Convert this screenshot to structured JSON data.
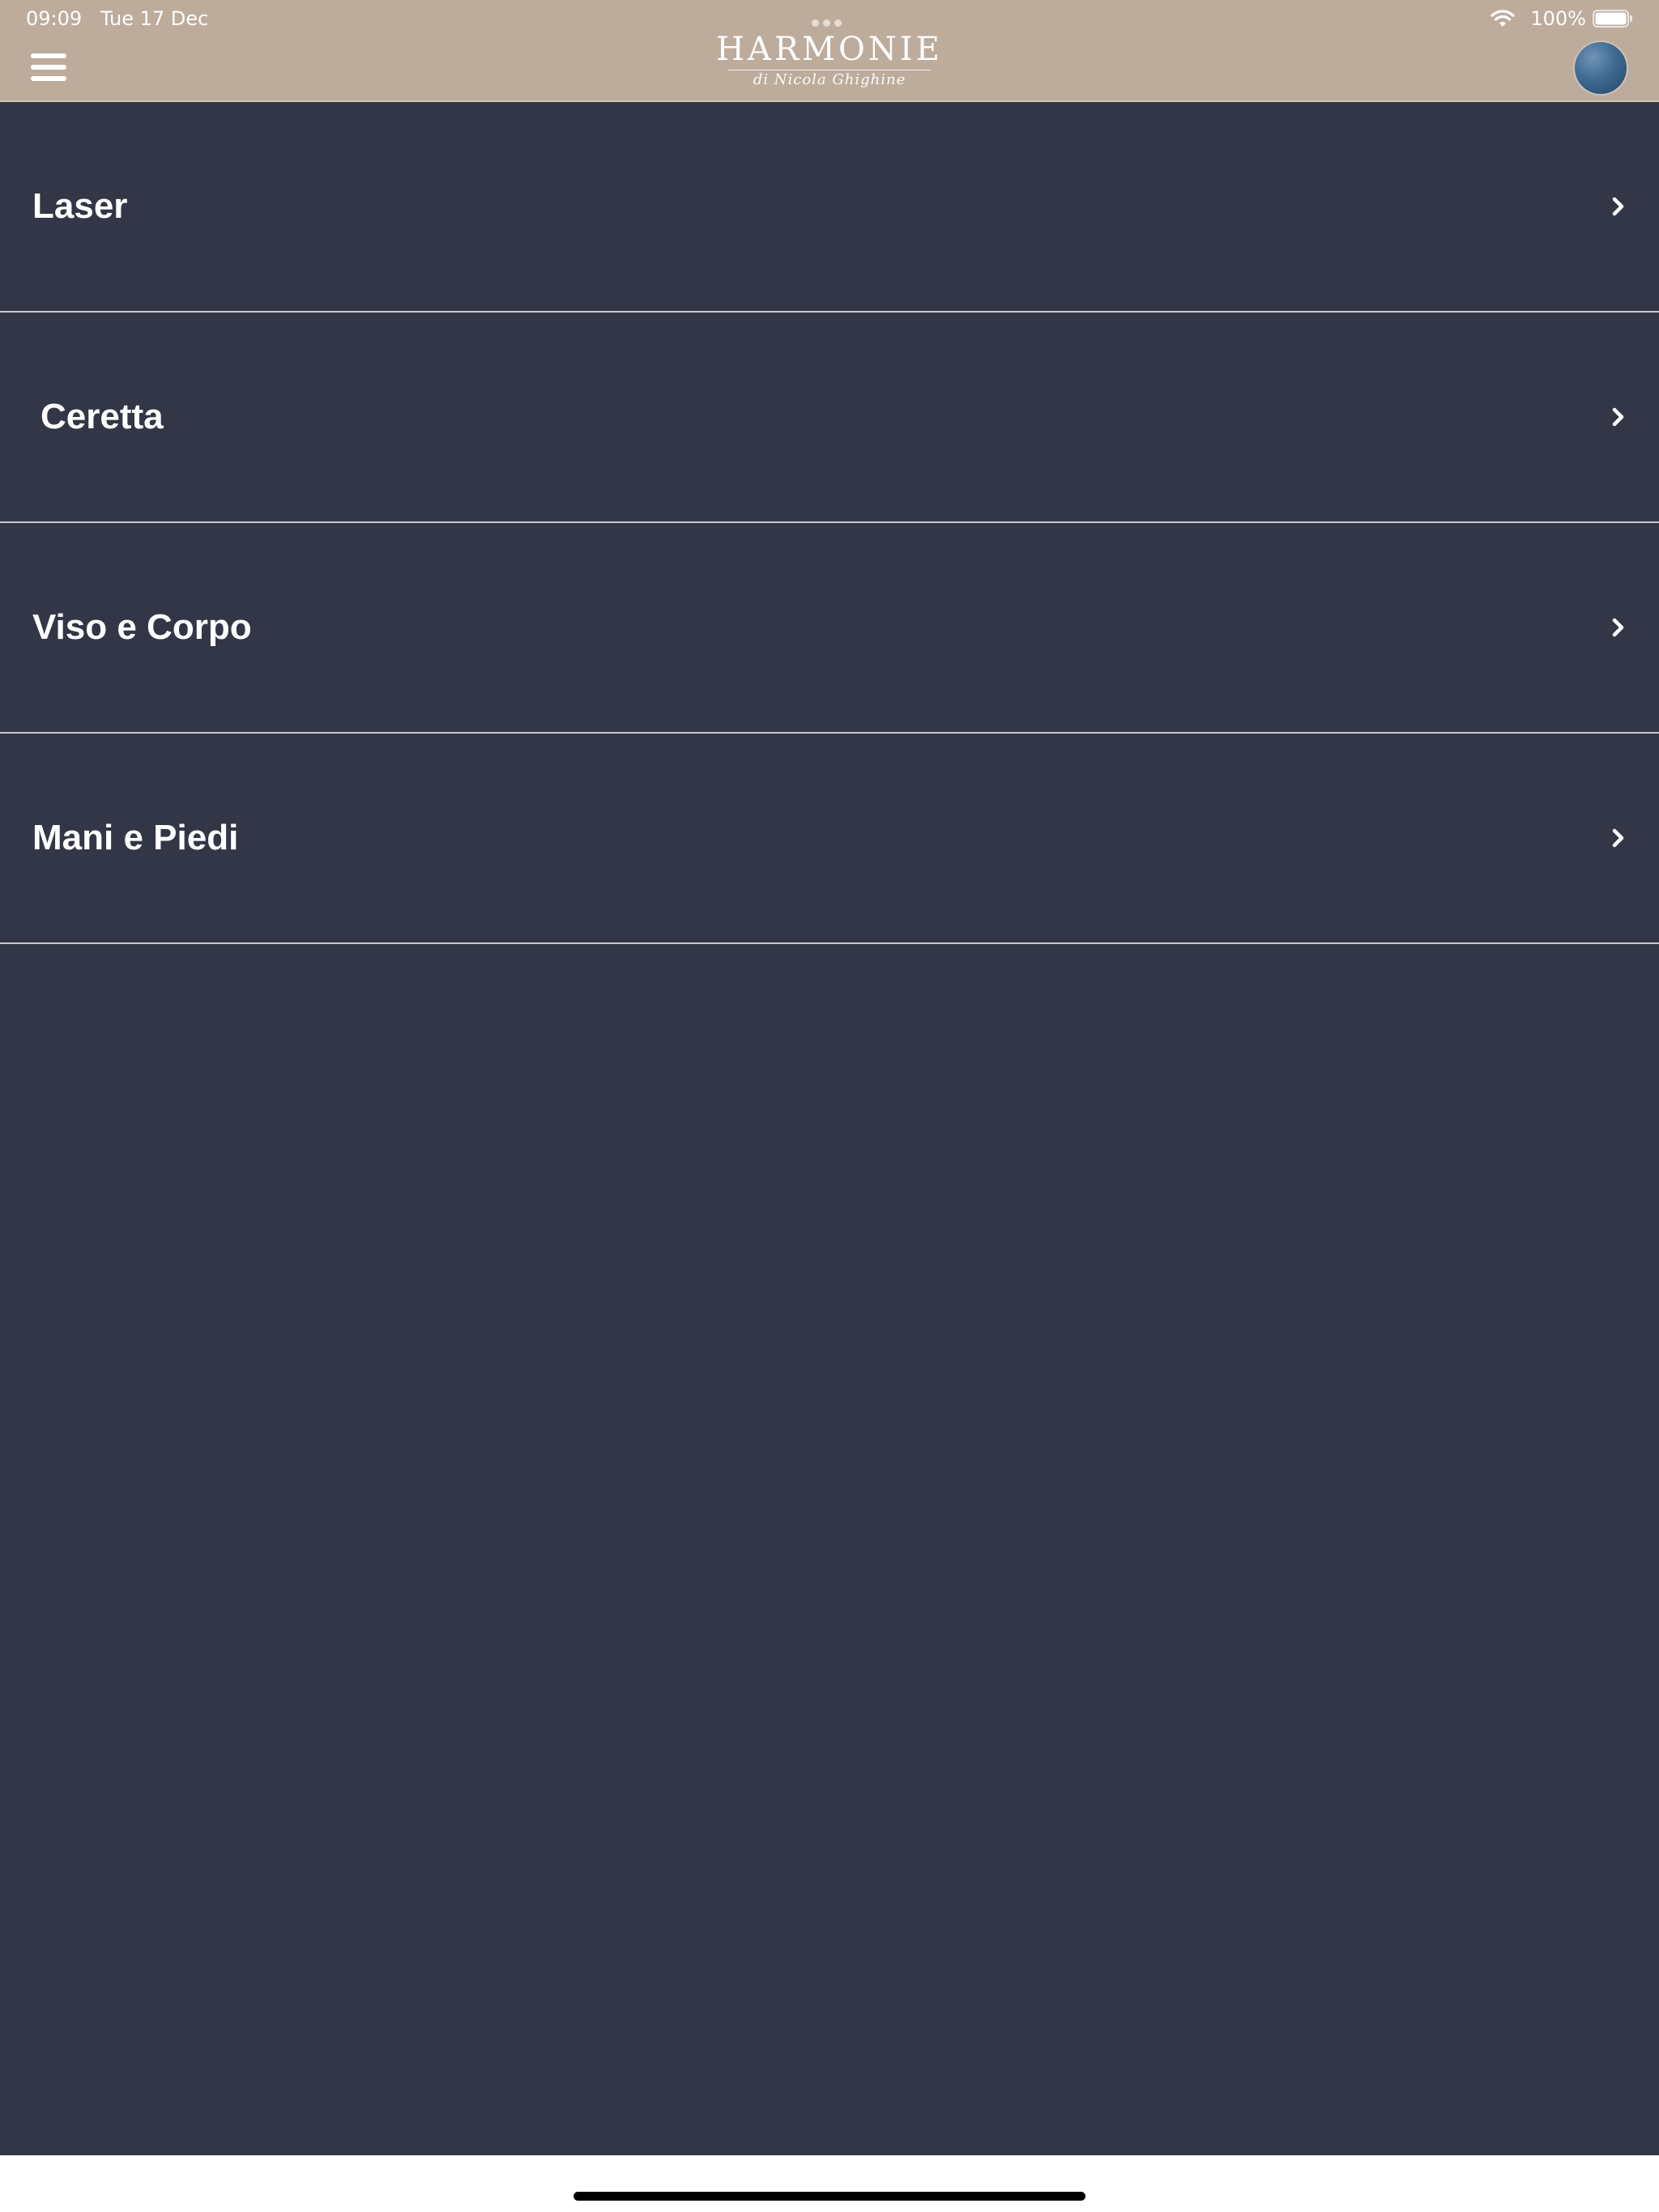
{
  "status_bar": {
    "time": "09:09",
    "date": "Tue 17 Dec",
    "battery": "100%"
  },
  "header": {
    "logo_title": "HARMONIE",
    "logo_subtitle": "di Nicola Ghighine",
    "background_color": "#bdac9c",
    "menu_icon": "hamburger-icon",
    "avatar_icon": "profile-avatar"
  },
  "menu": {
    "items": [
      {
        "label": "Laser"
      },
      {
        "label": "Ceretta"
      },
      {
        "label": "Viso e Corpo"
      },
      {
        "label": "Mani e Piedi"
      }
    ],
    "background_color": "#333646",
    "chevron_icon": "chevron-right-icon"
  }
}
